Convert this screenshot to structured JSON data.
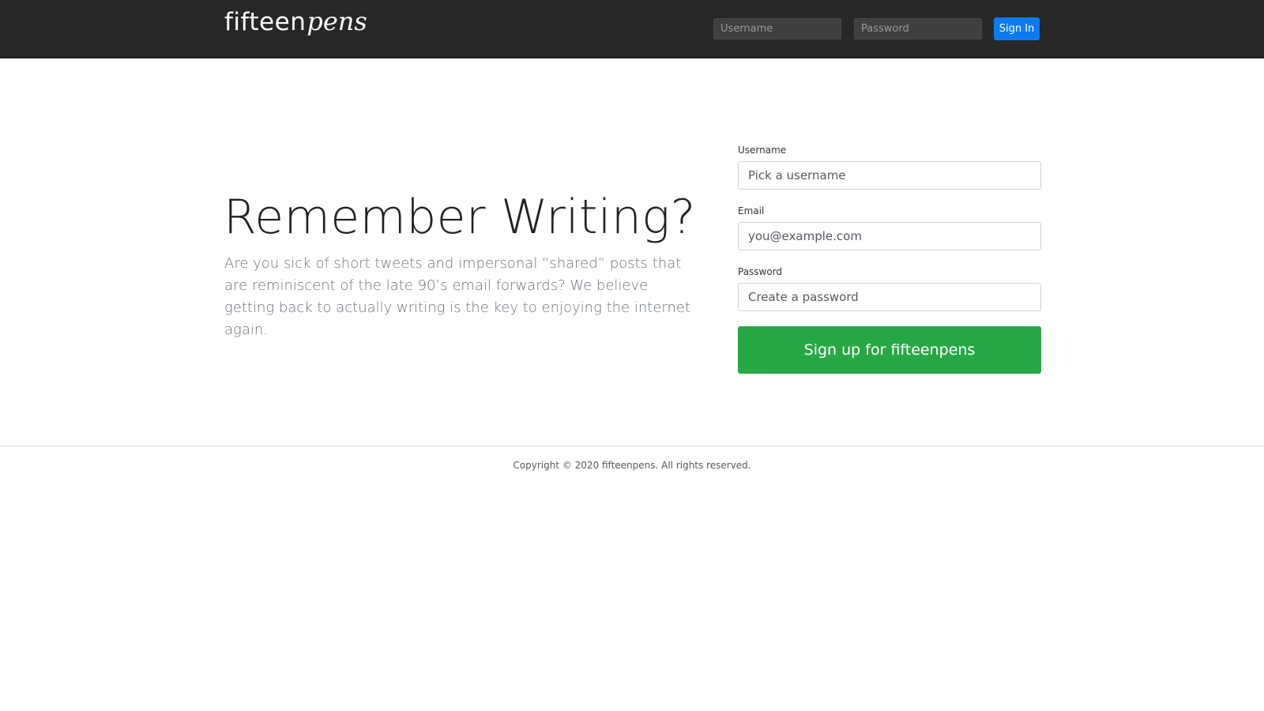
{
  "navbar": {
    "logo_main": "fifteen",
    "logo_script": "pens",
    "username_placeholder": "Username",
    "password_placeholder": "Password",
    "signin_label": "Sign In"
  },
  "hero": {
    "title": "Remember Writing?",
    "lead": "Are you sick of short tweets and impersonal “shared” posts that are reminiscent of the late 90’s email forwards? We believe getting back to actually writing is the key to enjoying the internet again."
  },
  "signup": {
    "username_label": "Username",
    "username_placeholder": "Pick a username",
    "email_label": "Email",
    "email_placeholder": "you@example.com",
    "password_label": "Password",
    "password_placeholder": "Create a password",
    "submit_label": "Sign up for fifteenpens",
    "button_color": "#28a745"
  },
  "footer": {
    "copyright": "Copyright © 2020 fifteenpens. All rights reserved."
  },
  "colors": {
    "navbar_bg": "#272727",
    "signin_button": "#0d7bf0"
  }
}
